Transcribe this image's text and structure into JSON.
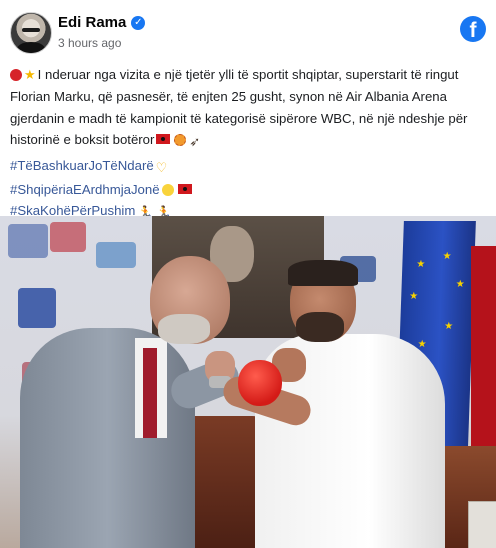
{
  "post": {
    "author": "Edi Rama",
    "verified_icon": "verified-check-icon",
    "timestamp": "3 hours ago",
    "platform_icon": "facebook-logo-icon",
    "text_line_1": "I nderuar nga vizita e një tjetër ylli të sportit shqiptar, superstarit të",
    "text_line_2": "ringut Florian Marku, që pasnesër, të enjten 25 gusht, synon në Air Albania",
    "text_line_3": "Arena gjerdanin e madh të kampionit të kategorisë sipërore WBC, në një",
    "text_line_4": "ndeshje për historinë e boksit botëror",
    "hashtags": [
      "#TëBashkuarJoTëNdarë",
      "#ShqipëriaEArdhmjaJonë",
      "#SkaKohëPërPushim"
    ],
    "emojis": [
      "boxing-glove",
      "star",
      "albanian-flag",
      "sports-medal",
      "eagle",
      "heart-hands",
      "sun",
      "runner"
    ],
    "photo_description_icon": "photo"
  },
  "colors": {
    "link": "#385898",
    "facebook_blue": "#1877f2",
    "meta_gray": "#65676b"
  }
}
